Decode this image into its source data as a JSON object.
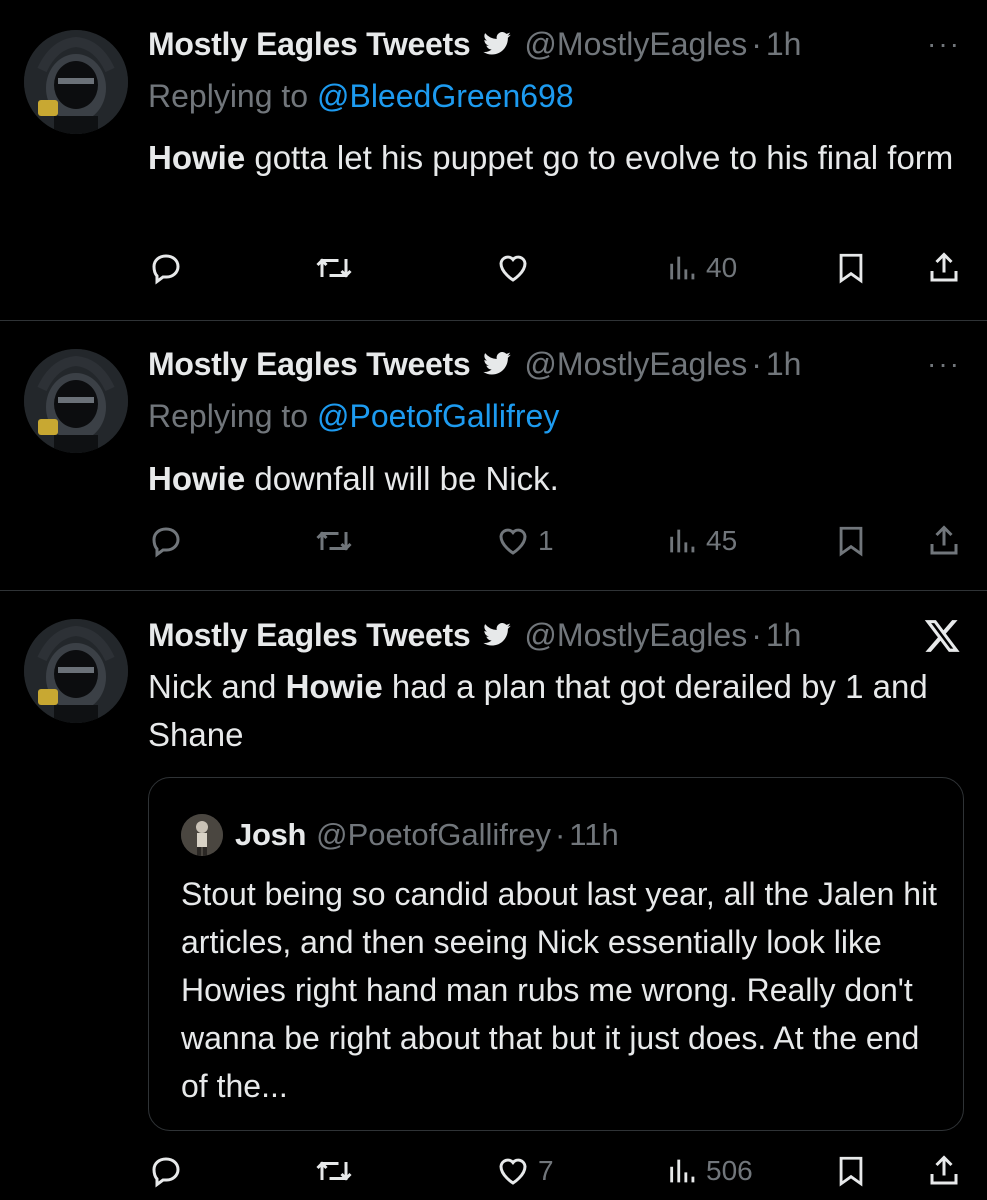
{
  "tweets": [
    {
      "author_name": "Mostly Eagles Tweets",
      "handle": "@MostlyEagles",
      "separator": "·",
      "time": "1h",
      "more": "···",
      "replying_prefix": "Replying to",
      "replying_to": "@BleedGreen698",
      "text_bold": "Howie",
      "text_rest": " gotta let his puppet go to evolve to his final form",
      "likes": "",
      "views": "40"
    },
    {
      "author_name": "Mostly Eagles Tweets",
      "handle": "@MostlyEagles",
      "separator": "·",
      "time": "1h",
      "more": "···",
      "replying_prefix": "Replying to",
      "replying_to": "@PoetofGallifrey",
      "text_bold": "Howie",
      "text_rest": " downfall will be Nick.",
      "likes": "1",
      "views": "45"
    },
    {
      "author_name": "Mostly Eagles Tweets",
      "handle": "@MostlyEagles",
      "separator": "·",
      "time": "1h",
      "text_pre": "Nick and ",
      "text_bold": "Howie",
      "text_rest": " had a plan that got derailed by 1 and Shane",
      "likes": "7",
      "views": "506",
      "quote": {
        "author_name": "Josh",
        "handle": "@PoetofGallifrey",
        "separator": "·",
        "time": "11h",
        "text": "Stout being so candid about last year, all the Jalen hit articles, and then seeing Nick essentially look like Howies right hand man rubs me wrong. Really don't wanna be right about that but it just does. At the end of the..."
      }
    }
  ],
  "icons": {
    "verified": "bird-icon",
    "reply": "reply-icon",
    "retweet": "retweet-icon",
    "like": "heart-icon",
    "views": "views-icon",
    "bookmark": "bookmark-icon",
    "share": "share-icon",
    "x_logo": "x-logo-icon"
  },
  "colors": {
    "background": "#000000",
    "text": "#e7e9ea",
    "secondary": "#71767b",
    "link": "#1d9bf0",
    "divider": "#2f3336"
  }
}
